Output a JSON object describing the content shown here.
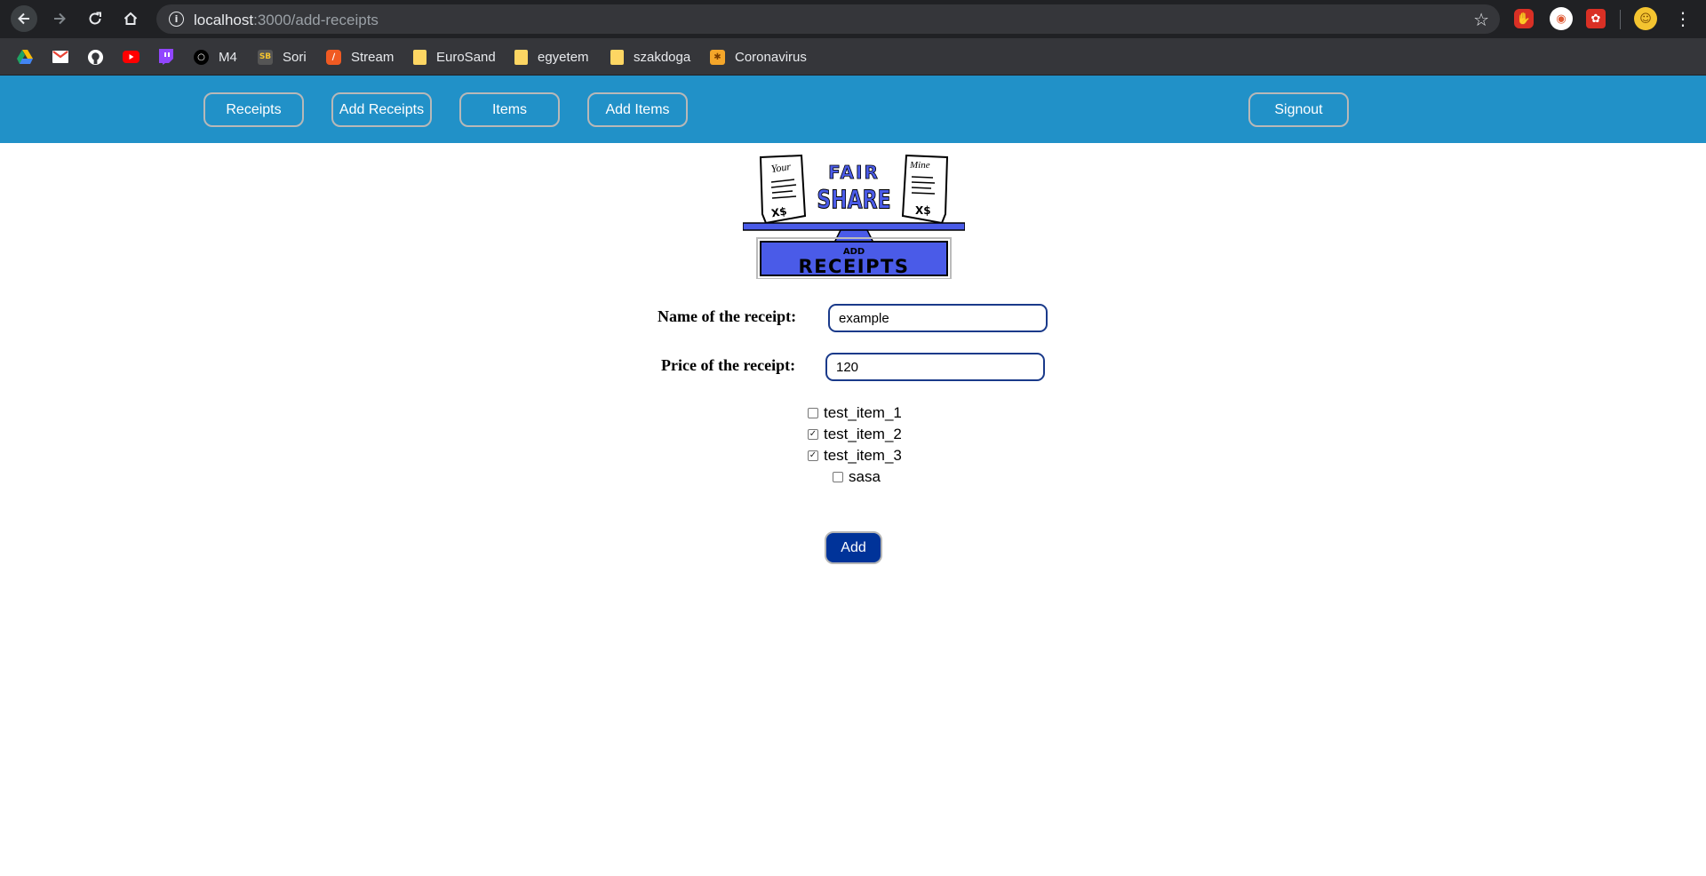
{
  "browser": {
    "url_host": "localhost",
    "url_path": ":3000/add-receipts",
    "bookmarks": [
      {
        "label": "",
        "icon": "google-drive-icon",
        "color": "#1fa463"
      },
      {
        "label": "",
        "icon": "gmail-icon",
        "color": "#ea4335"
      },
      {
        "label": "",
        "icon": "github-icon",
        "color": "#ffffff"
      },
      {
        "label": "",
        "icon": "youtube-icon",
        "color": "#ff0000"
      },
      {
        "label": "",
        "icon": "twitch-icon",
        "color": "#9146ff"
      },
      {
        "label": "M4",
        "icon": "m4-icon"
      },
      {
        "label": "Sori",
        "icon": "sb-icon"
      },
      {
        "label": "Stream",
        "icon": "stream-icon"
      },
      {
        "label": "EuroSand",
        "icon": "folder-icon"
      },
      {
        "label": "egyetem",
        "icon": "folder-icon"
      },
      {
        "label": "szakdoga",
        "icon": "folder-icon"
      },
      {
        "label": "Coronavirus",
        "icon": "coronavirus-icon"
      }
    ]
  },
  "nav": {
    "receipts": "Receipts",
    "add_receipts": "Add Receipts",
    "items": "Items",
    "add_items": "Add Items",
    "signout": "Signout"
  },
  "logo": {
    "left_receipt": "Your",
    "right_receipt": "Mine",
    "left_amount": "X$",
    "right_amount": "X$",
    "title_top": "FAIR",
    "title_bottom": "SHARE",
    "banner_small": "ADD",
    "banner_big": "RECEIPTS"
  },
  "form": {
    "name_label": "Name of the receipt:",
    "name_value": "example",
    "price_label": "Price of the receipt:",
    "price_value": "120",
    "items": [
      {
        "label": "test_item_1",
        "checked": false
      },
      {
        "label": "test_item_2",
        "checked": true
      },
      {
        "label": "test_item_3",
        "checked": true
      },
      {
        "label": "sasa",
        "checked": false
      }
    ],
    "add_label": "Add"
  },
  "colors": {
    "header_bg": "#2191c8",
    "add_button_bg": "#003399",
    "input_border": "#1a3a8a",
    "logo_blue": "#4a5be8"
  }
}
